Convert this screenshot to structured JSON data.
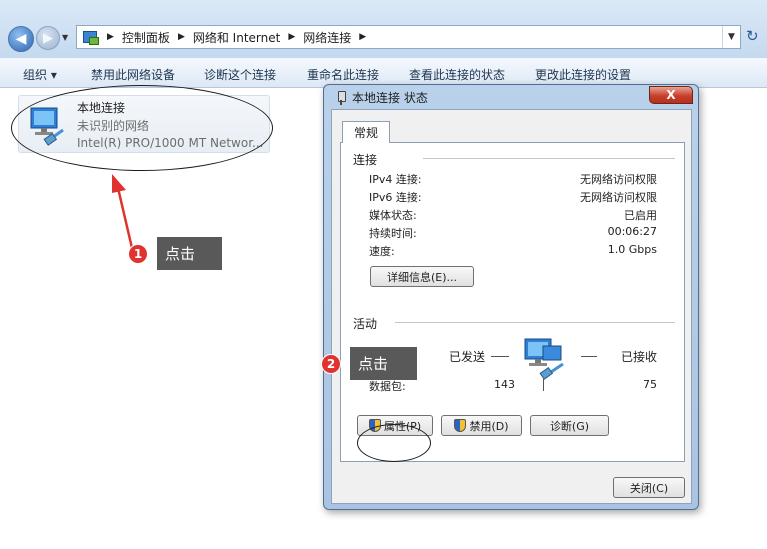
{
  "nav": {
    "back_icon": "back-arrow-icon",
    "forward_icon": "forward-arrow-icon",
    "breadcrumb": [
      "控制面板",
      "网络和 Internet",
      "网络连接"
    ]
  },
  "toolbar": {
    "organize": "组织 ▾",
    "disable": "禁用此网络设备",
    "diagnose": "诊断这个连接",
    "rename": "重命名此连接",
    "view_status": "查看此连接的状态",
    "change_settings": "更改此连接的设置"
  },
  "connection": {
    "name": "本地连接",
    "status": "未识别的网络",
    "device": "Intel(R) PRO/1000 MT Networ..."
  },
  "callouts": [
    {
      "number": "1",
      "text": "点击"
    },
    {
      "number": "2",
      "text": "点击"
    }
  ],
  "dialog": {
    "title": "本地连接 状态",
    "close_label": "X",
    "tab": "常规",
    "connection_group": "连接",
    "rows": [
      {
        "label": "IPv4 连接:",
        "value": "无网络访问权限"
      },
      {
        "label": "IPv6 连接:",
        "value": "无网络访问权限"
      },
      {
        "label": "媒体状态:",
        "value": "已启用"
      },
      {
        "label": "持续时间:",
        "value": "00:06:27"
      },
      {
        "label": "速度:",
        "value": "1.0 Gbps"
      }
    ],
    "details_button": "详细信息(E)...",
    "activity_group": "活动",
    "sent_label": "已发送",
    "received_label": "已接收",
    "packets_label": "数据包:",
    "packets_sent": "143",
    "packets_received": "75",
    "properties_button": "属性(P)",
    "disable_button": "禁用(D)",
    "diagnose_button": "诊断(G)",
    "close_button": "关闭(C)"
  },
  "colors": {
    "accent_red": "#e0322f",
    "callout_bg": "#595959"
  }
}
